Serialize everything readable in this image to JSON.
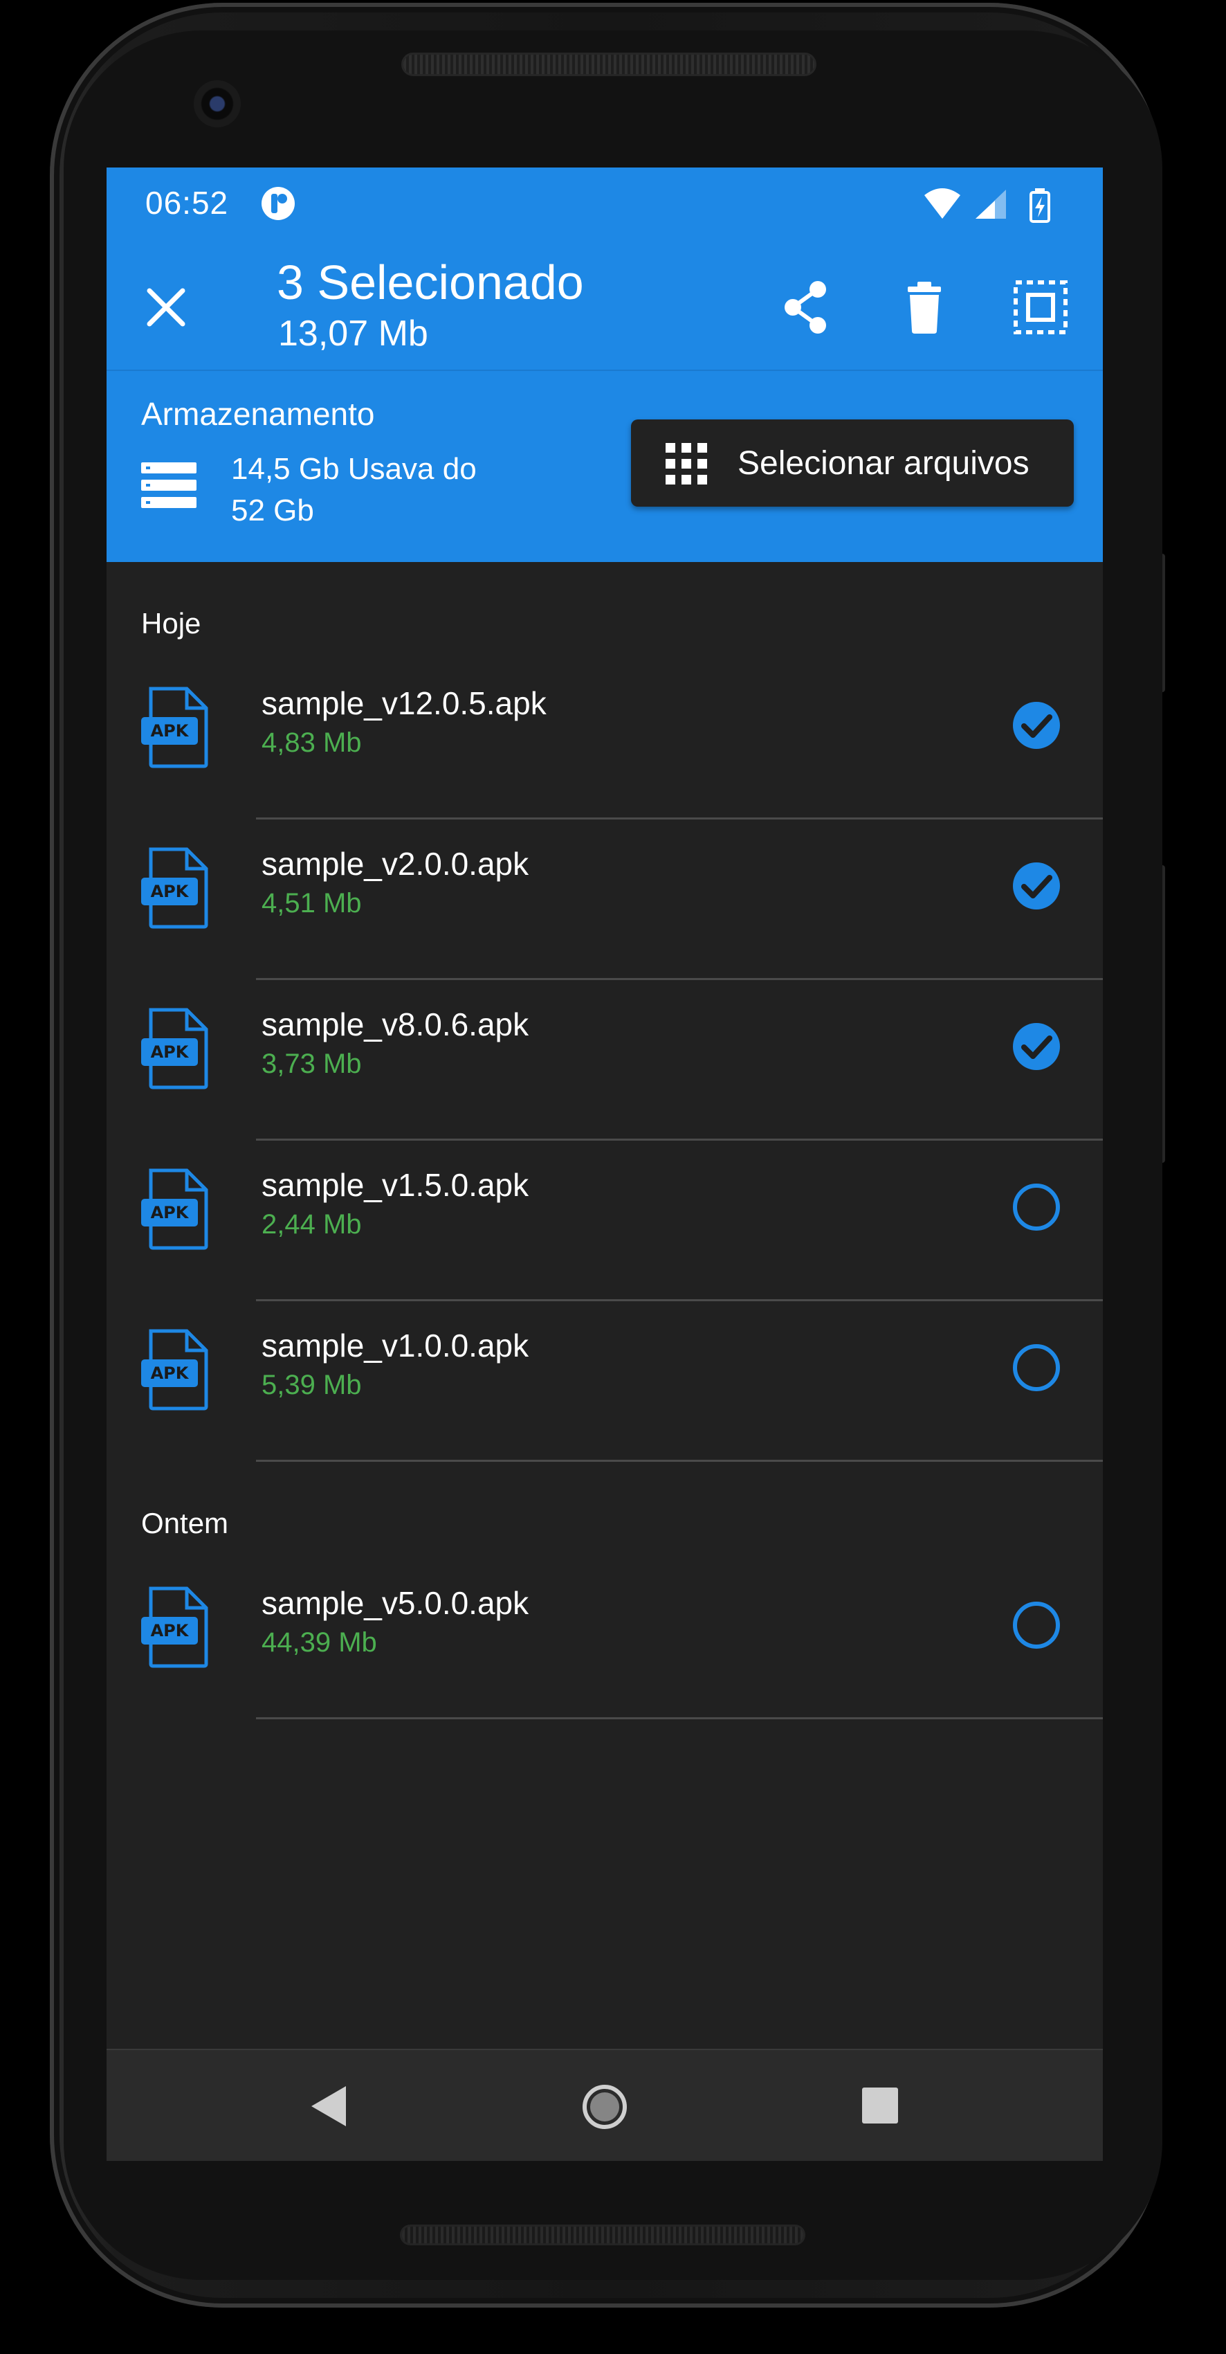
{
  "status_bar": {
    "time": "06:52"
  },
  "app_bar": {
    "title": "3 Selecionado",
    "subtitle": "13,07 Mb",
    "actions": [
      "close-icon",
      "share-icon",
      "delete-icon",
      "select-all-icon"
    ]
  },
  "storage": {
    "label": "Armazenamento",
    "usage_line1": "14,5 Gb Usava do",
    "usage_line2": "52 Gb",
    "select_button_label": "Selecionar arquivos"
  },
  "sections": [
    {
      "header": "Hoje",
      "files": [
        {
          "name": "sample_v12.0.5.apk",
          "size": "4,83 Mb",
          "checked": true,
          "icon_label": "APK"
        },
        {
          "name": "sample_v2.0.0.apk",
          "size": "4,51 Mb",
          "checked": true,
          "icon_label": "APK"
        },
        {
          "name": "sample_v8.0.6.apk",
          "size": "3,73 Mb",
          "checked": true,
          "icon_label": "APK"
        },
        {
          "name": "sample_v1.5.0.apk",
          "size": "2,44 Mb",
          "checked": false,
          "icon_label": "APK"
        },
        {
          "name": "sample_v1.0.0.apk",
          "size": "5,39 Mb",
          "checked": false,
          "icon_label": "APK"
        }
      ]
    },
    {
      "header": "Ontem",
      "files": [
        {
          "name": "sample_v5.0.0.apk",
          "size": "44,39 Mb",
          "checked": false,
          "icon_label": "APK"
        }
      ]
    }
  ],
  "colors": {
    "accent": "#1e88e5",
    "background": "#212121",
    "size_text": "#4caf50",
    "button_dark": "#222222"
  }
}
